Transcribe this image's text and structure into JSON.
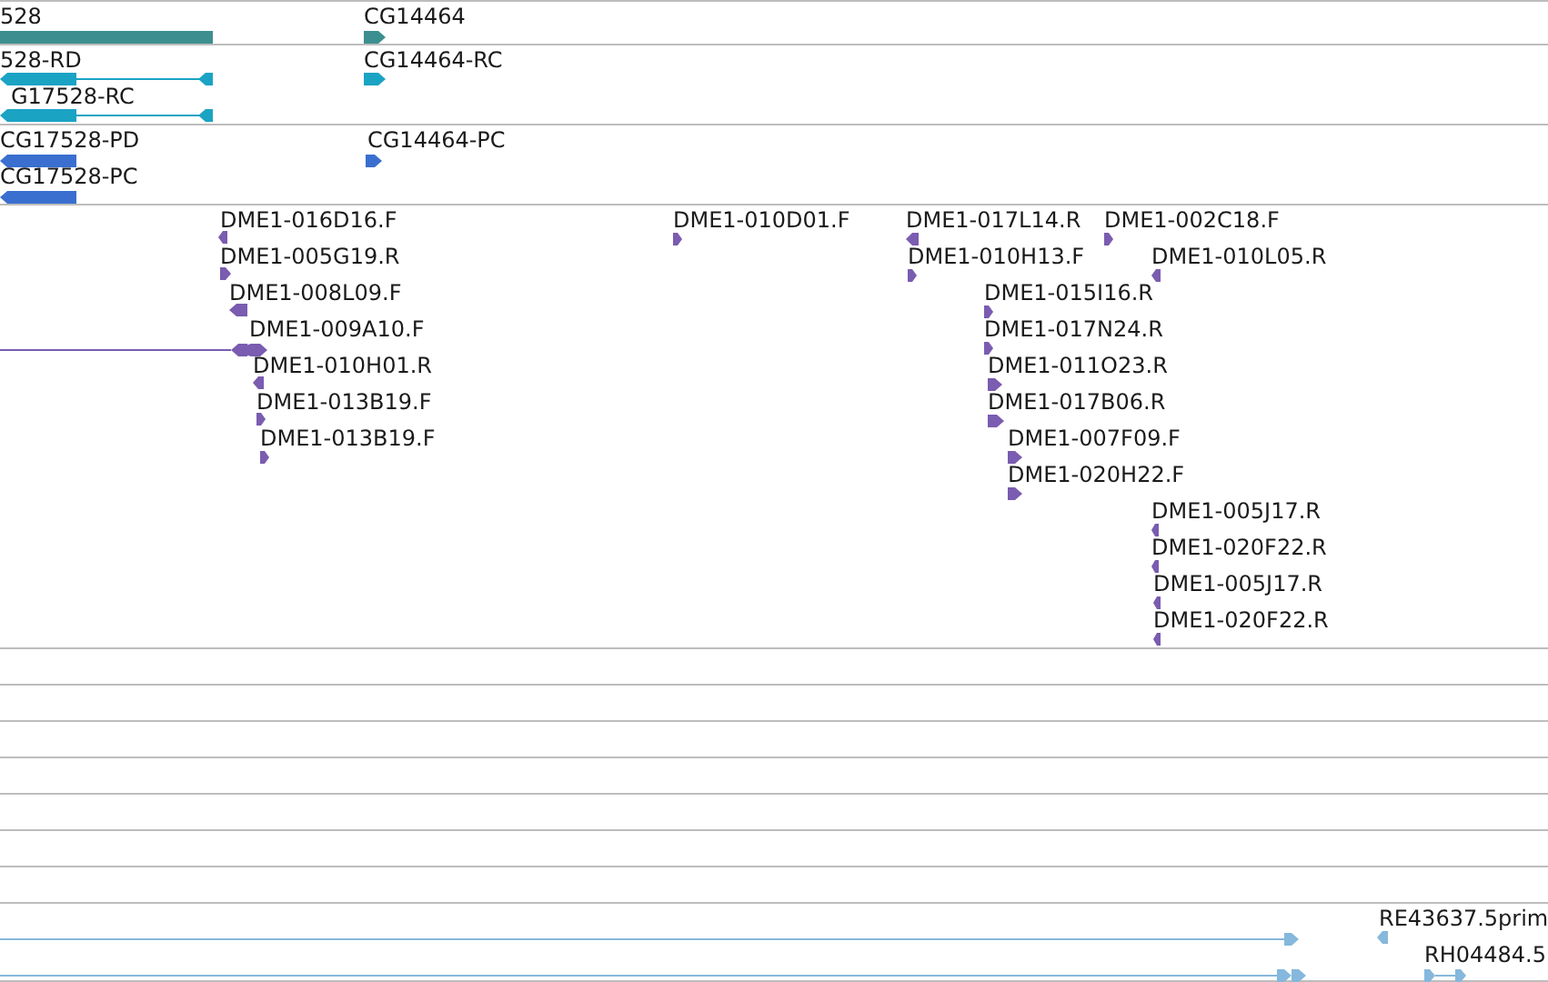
{
  "tracks": [
    {
      "kind": "gene",
      "features": [
        {
          "label": "528",
          "kind": "bar"
        },
        {
          "label": "CG14464",
          "kind": "forward"
        }
      ]
    },
    {
      "kind": "transcript",
      "features": [
        {
          "label": "528-RD",
          "kind": "reverse"
        },
        {
          "label": "G17528-RC",
          "kind": "reverse"
        },
        {
          "label": "CG14464-RC",
          "kind": "forward"
        }
      ]
    },
    {
      "kind": "protein",
      "features": [
        {
          "label": "CG17528-PD",
          "kind": "reverse"
        },
        {
          "label": "CG17528-PC",
          "kind": "reverse"
        },
        {
          "label": "CG14464-PC",
          "kind": "forward"
        }
      ]
    },
    {
      "kind": "clone",
      "features": [
        {
          "label": "DME1-016D16.F",
          "kind": "reverse"
        },
        {
          "label": "DME1-005G19.R",
          "kind": "forward"
        },
        {
          "label": "DME1-008L09.F",
          "kind": "reverse"
        },
        {
          "label": "DME1-009A10.F",
          "kind": "both"
        },
        {
          "label": "DME1-010H01.R",
          "kind": "reverse"
        },
        {
          "label": "DME1-013B19.F",
          "kind": "forward"
        },
        {
          "label": "DME1-013B19.F",
          "kind": "forward"
        },
        {
          "label": "DME1-010D01.F",
          "kind": "forward"
        },
        {
          "label": "DME1-017L14.R",
          "kind": "reverse"
        },
        {
          "label": "DME1-002C18.F",
          "kind": "forward"
        },
        {
          "label": "DME1-010H13.F",
          "kind": "forward"
        },
        {
          "label": "DME1-010L05.R",
          "kind": "reverse"
        },
        {
          "label": "DME1-015I16.R",
          "kind": "forward"
        },
        {
          "label": "DME1-017N24.R",
          "kind": "forward"
        },
        {
          "label": "DME1-011O23.R",
          "kind": "forward"
        },
        {
          "label": "DME1-017B06.R",
          "kind": "forward"
        },
        {
          "label": "DME1-007F09.F",
          "kind": "forward"
        },
        {
          "label": "DME1-020H22.F",
          "kind": "forward"
        },
        {
          "label": "DME1-005J17.R",
          "kind": "reverse"
        },
        {
          "label": "DME1-020F22.R",
          "kind": "reverse"
        },
        {
          "label": "DME1-005J17.R",
          "kind": "reverse"
        },
        {
          "label": "DME1-020F22.R",
          "kind": "reverse"
        }
      ]
    },
    {
      "kind": "empty"
    },
    {
      "kind": "empty"
    },
    {
      "kind": "empty"
    },
    {
      "kind": "empty"
    },
    {
      "kind": "empty"
    },
    {
      "kind": "empty"
    },
    {
      "kind": "empty"
    },
    {
      "kind": "est",
      "features": [
        {
          "kind": "forward"
        },
        {
          "label": "RE43637.5prim",
          "kind": "reverse"
        },
        {
          "kind": "forward"
        },
        {
          "label": "RH04484.5",
          "kind": "forward"
        }
      ]
    }
  ]
}
